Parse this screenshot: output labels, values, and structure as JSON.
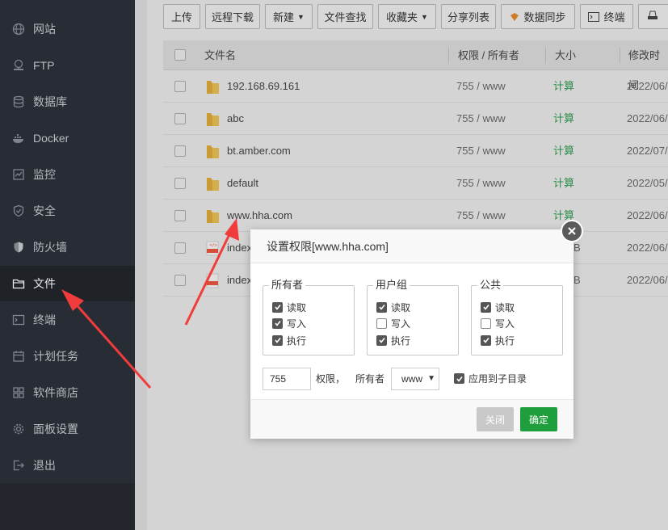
{
  "sidebar": {
    "items": [
      {
        "label": "网站",
        "icon": "globe-icon"
      },
      {
        "label": "FTP",
        "icon": "ftp-icon"
      },
      {
        "label": "数据库",
        "icon": "database-icon"
      },
      {
        "label": "Docker",
        "icon": "docker-icon"
      },
      {
        "label": "监控",
        "icon": "monitor-icon"
      },
      {
        "label": "安全",
        "icon": "shield-icon"
      },
      {
        "label": "防火墙",
        "icon": "firewall-icon"
      },
      {
        "label": "文件",
        "icon": "folder-icon"
      },
      {
        "label": "终端",
        "icon": "terminal-icon"
      },
      {
        "label": "计划任务",
        "icon": "calendar-icon"
      },
      {
        "label": "软件商店",
        "icon": "apps-icon"
      },
      {
        "label": "面板设置",
        "icon": "gear-icon"
      },
      {
        "label": "退出",
        "icon": "logout-icon"
      }
    ],
    "active_label": "文件"
  },
  "toolbar": {
    "upload": "上传",
    "remote_download": "远程下载",
    "new": "新建",
    "file_search": "文件查找",
    "favorites": "收藏夹",
    "share_list": "分享列表",
    "data_sync": "数据同步",
    "terminal": "终端"
  },
  "table": {
    "columns": [
      "文件名",
      "权限 / 所有者",
      "大小",
      "修改时间"
    ],
    "rows": [
      {
        "name": "192.168.69.161",
        "perm": "755 / www",
        "size": "计算",
        "date": "2022/06/",
        "type": "folder"
      },
      {
        "name": "abc",
        "perm": "755 / www",
        "size": "计算",
        "date": "2022/06/",
        "type": "folder"
      },
      {
        "name": "bt.amber.com",
        "perm": "755 / www",
        "size": "计算",
        "date": "2022/07/",
        "type": "folder"
      },
      {
        "name": "default",
        "perm": "755 / www",
        "size": "计算",
        "date": "2022/05/",
        "type": "folder"
      },
      {
        "name": "www.hha.com",
        "perm": "755 / www",
        "size": "计算",
        "date": "2022/06/",
        "type": "folder"
      },
      {
        "name": "index",
        "perm": "",
        "size": "B",
        "date": "2022/06/",
        "type": "html"
      },
      {
        "name": "index",
        "perm": "",
        "size": "B",
        "date": "2022/06/",
        "type": "html"
      }
    ]
  },
  "dialog": {
    "title": "设置权限[www.hha.com]",
    "groups": [
      {
        "label": "所有者",
        "read": {
          "label": "读取",
          "checked": true
        },
        "write": {
          "label": "写入",
          "checked": true
        },
        "exec": {
          "label": "执行",
          "checked": true
        }
      },
      {
        "label": "用户组",
        "read": {
          "label": "读取",
          "checked": true
        },
        "write": {
          "label": "写入",
          "checked": false
        },
        "exec": {
          "label": "执行",
          "checked": true
        }
      },
      {
        "label": "公共",
        "read": {
          "label": "读取",
          "checked": true
        },
        "write": {
          "label": "写入",
          "checked": false
        },
        "exec": {
          "label": "执行",
          "checked": true
        }
      }
    ],
    "perm_value": "755",
    "perm_label": "权限，",
    "owner_label": "所有者",
    "owner_value": "www",
    "apply_sub": {
      "label": "应用到子目录",
      "checked": true
    },
    "close_btn": "关闭",
    "ok_btn": "确定"
  },
  "colors": {
    "sidebar_bg": "#2c313a",
    "accent_green": "#1e9e3c",
    "calc_green": "#2e9b4c",
    "arrow_red": "#f03c3c"
  }
}
